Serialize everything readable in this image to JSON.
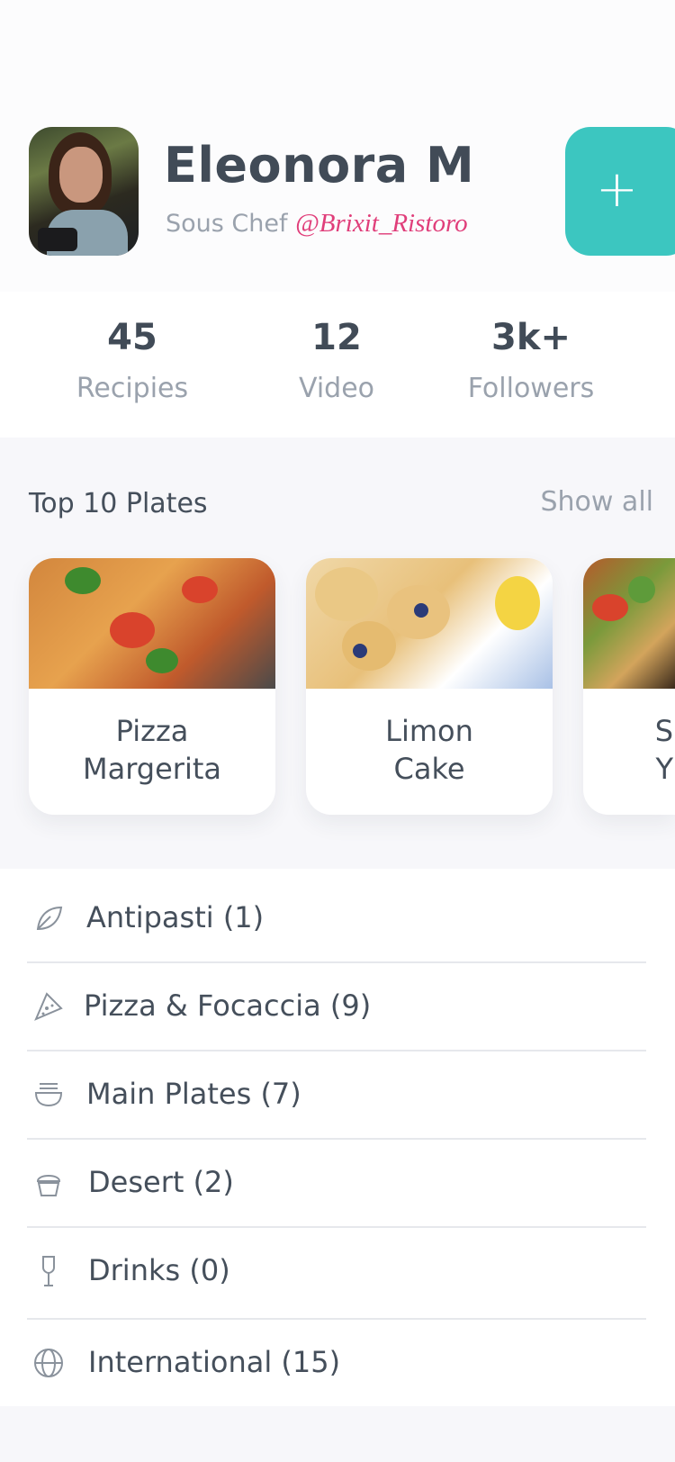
{
  "profile": {
    "name": "Eleonora M",
    "role": "Sous Chef",
    "handle": "@Brixit_Ristoro",
    "add_label": "+"
  },
  "stats": [
    {
      "value": "45",
      "label": "Recipies"
    },
    {
      "value": "12",
      "label": "Video"
    },
    {
      "value": "3k+",
      "label": "Followers"
    }
  ],
  "top_plates": {
    "title": "Top 10 Plates",
    "show_all": "Show all",
    "items": [
      {
        "line1": "Pizza",
        "line2": "Margerita"
      },
      {
        "line1": "Limon",
        "line2": "Cake"
      },
      {
        "line1": "S",
        "line2": "Y"
      }
    ]
  },
  "categories": [
    {
      "label": "Antipasti (1)",
      "icon": "leaf-icon"
    },
    {
      "label": "Pizza & Focaccia (9)",
      "icon": "pizza-slice-icon"
    },
    {
      "label": "Main Plates (7)",
      "icon": "bowl-icon"
    },
    {
      "label": "Desert (2)",
      "icon": "cupcake-icon"
    },
    {
      "label": "Drinks (0)",
      "icon": "wine-glass-icon"
    },
    {
      "label": "International (15)",
      "icon": "globe-icon"
    }
  ],
  "colors": {
    "accent": "#3cc6c0",
    "handle": "#e03e7a",
    "text": "#454f5b",
    "muted": "#9aa2ad"
  }
}
